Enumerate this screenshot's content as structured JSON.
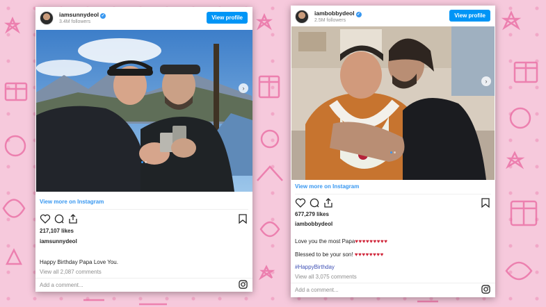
{
  "colors": {
    "accent": "#0095f6",
    "link": "#3897f0",
    "heart": "#d0263a",
    "background": "#f6c9dc",
    "background_art": "#e968a0"
  },
  "posts": [
    {
      "username": "iamsunnydeol",
      "followers": "3.4M followers",
      "view_profile": "View profile",
      "view_more": "View more on Instagram",
      "likes": "217,107 likes",
      "caption_username": "iamsunnydeol",
      "caption_lines": [
        "Happy Birthday Papa Love You."
      ],
      "view_all": "View all 2,087 comments",
      "add_comment": "Add a comment...",
      "icons": [
        "verified-icon",
        "heart-icon",
        "comment-icon",
        "share-icon",
        "bookmark-icon",
        "instagram-icon"
      ]
    },
    {
      "username": "iambobbydeol",
      "followers": "2.5M followers",
      "view_profile": "View profile",
      "view_more": "View more on Instagram",
      "likes": "677,279 likes",
      "caption_username": "iambobbydeol",
      "caption_line1": "Love you the most Papa",
      "caption_line1_hearts": "♥♥♥♥♥♥♥♥♥",
      "caption_line2": "Blessed to be your son!",
      "caption_line2_hearts": "♥♥♥♥♥♥♥♥",
      "hashtag": "#HappyBirthday",
      "view_all": "View all 3,075 comments",
      "add_comment": "Add a comment...",
      "icons": [
        "verified-icon",
        "heart-icon",
        "comment-icon",
        "share-icon",
        "bookmark-icon",
        "instagram-icon"
      ]
    }
  ]
}
